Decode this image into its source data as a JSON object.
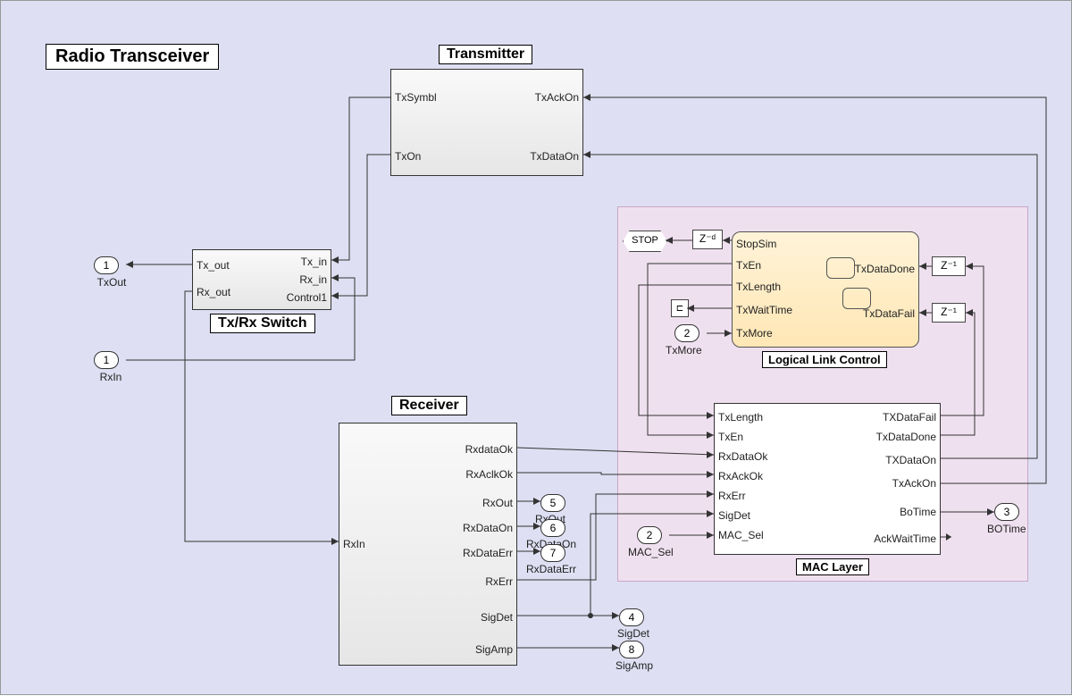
{
  "title": "Radio Transceiver",
  "blocks": {
    "transmitter": {
      "title": "Transmitter",
      "ports_left": [
        "TxSymbl",
        "TxOn"
      ],
      "ports_right": [
        "TxAckOn",
        "TxDataOn"
      ]
    },
    "switch": {
      "title": "Tx/Rx Switch",
      "ports_left": [
        "Tx_out",
        "Rx_out"
      ],
      "ports_right": [
        "Tx_in",
        "Rx_in",
        "Control1"
      ]
    },
    "receiver": {
      "title": "Receiver",
      "ports_left": [
        "RxIn"
      ],
      "ports_right": [
        "RxdataOk",
        "RxAclkOk",
        "RxOut",
        "RxDataOn",
        "RxDataErr",
        "RxErr",
        "SigDet",
        "SigAmp"
      ]
    },
    "llc": {
      "title": "Logical Link Control",
      "ports_left": [
        "StopSim",
        "TxEn",
        "TxLength",
        "TxWaitTime",
        "TxMore"
      ],
      "ports_right": [
        "TxDataDone",
        "TxDataFail"
      ]
    },
    "mac": {
      "title": "MAC Layer",
      "ports_left": [
        "TxLength",
        "TxEn",
        "RxDataOk",
        "RxAckOk",
        "RxErr",
        "SigDet",
        "MAC_Sel"
      ],
      "ports_right": [
        "TXDataFail",
        "TxDataDone",
        "TXDataOn",
        "TxAckOn",
        "BoTime",
        "AckWaitTime"
      ]
    }
  },
  "io": {
    "txout": {
      "num": "1",
      "label": "TxOut"
    },
    "rxin": {
      "num": "1",
      "label": "RxIn"
    },
    "rxout": {
      "num": "5",
      "label": "RxOut"
    },
    "rxdataon": {
      "num": "6",
      "label": "RxDataOn"
    },
    "rxdataerr": {
      "num": "7",
      "label": "RxDataErr"
    },
    "sigdet": {
      "num": "4",
      "label": "SigDet"
    },
    "sigamp": {
      "num": "8",
      "label": "SigAmp"
    },
    "botime": {
      "num": "3",
      "label": "BOTime"
    },
    "txmore": {
      "num": "2",
      "label": "TxMore"
    },
    "macsel": {
      "num": "2",
      "label": "MAC_Sel"
    }
  },
  "misc": {
    "stop": "STOP",
    "zd": "Z⁻ᵈ",
    "z1a": "Z⁻¹",
    "z1b": "Z⁻¹",
    "term": "⊏"
  }
}
